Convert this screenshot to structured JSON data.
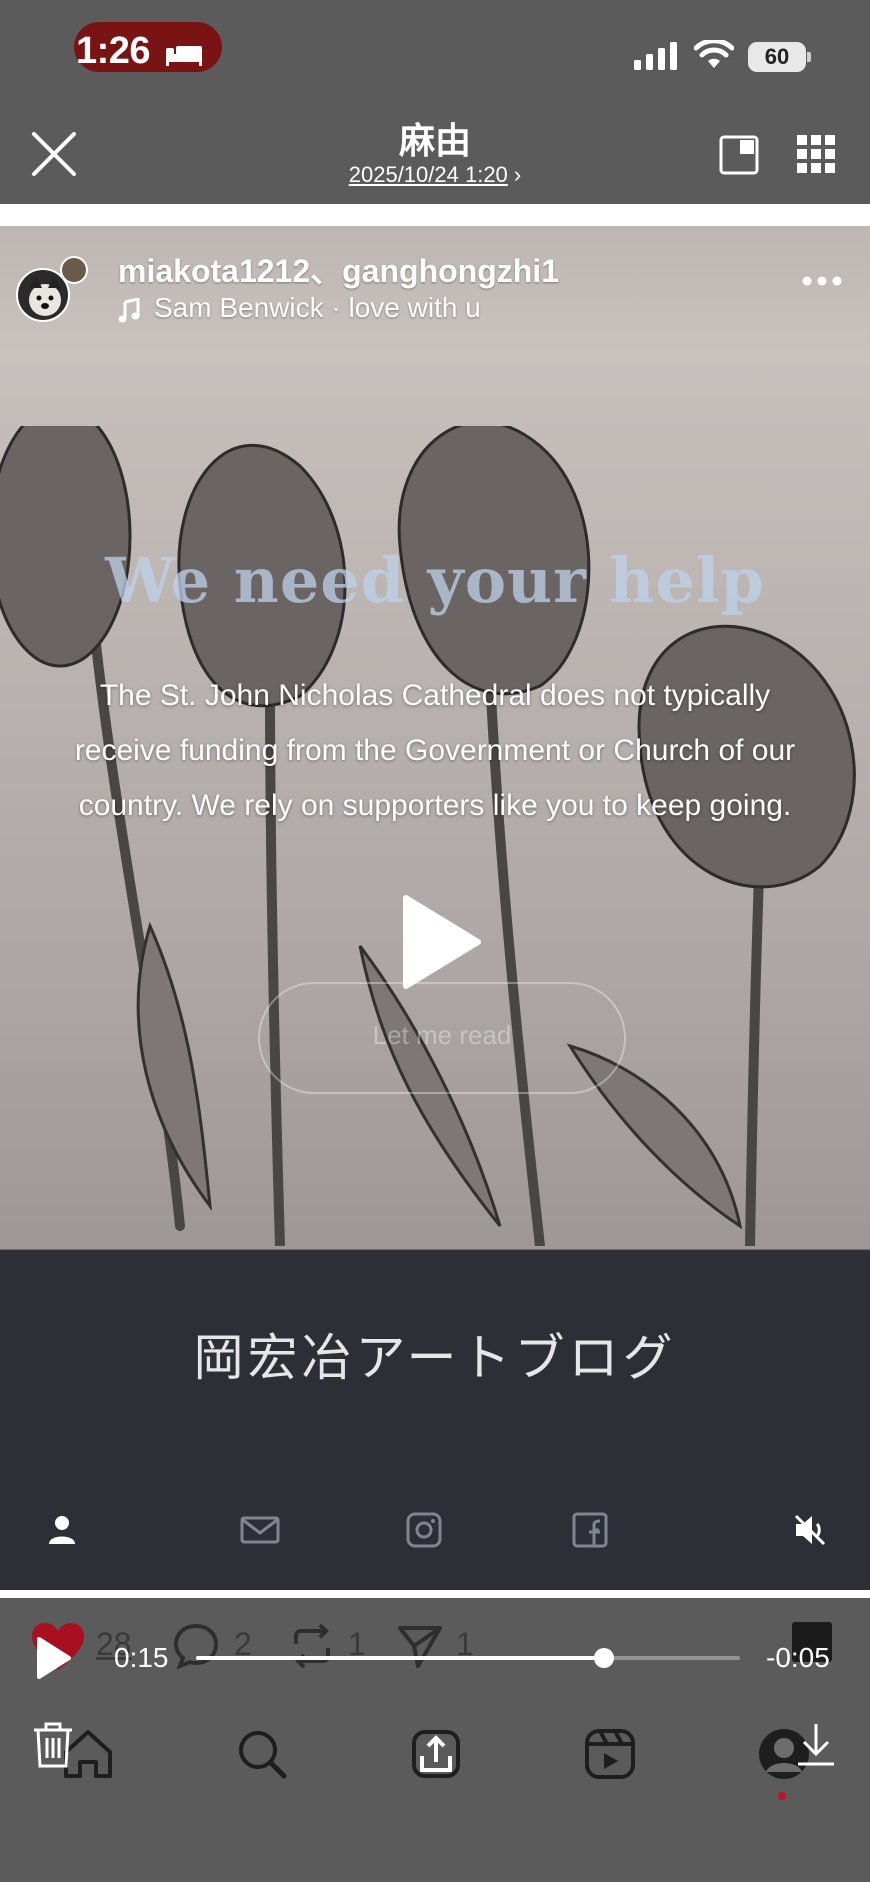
{
  "status_bar": {
    "time": "1:26",
    "battery": "60",
    "icons": [
      "sleep-icon",
      "cellular-signal-icon",
      "wifi-icon",
      "battery-icon"
    ]
  },
  "header": {
    "title": "麻由",
    "subtitle": "2025/10/24 1:20",
    "subtitle_suffix": "›",
    "icons": [
      "close-icon",
      "picture-in-picture-icon",
      "grid-icon"
    ]
  },
  "post": {
    "usernames": "miakota1212、ganghongzhi1",
    "music": "Sam Benwick · love with u",
    "help_title": "We need your help",
    "help_body": "The St. John Nicholas Cathedral does not typically receive funding from the Government or Church of our country. We rely on supporters like you to keep going.",
    "ghost_button": "Let me read",
    "blog_title": "岡宏冶アートブログ",
    "social_icons": [
      "person-icon",
      "mail-icon",
      "instagram-icon",
      "facebook-icon"
    ],
    "mute_icon": "muted-speaker-icon"
  },
  "actions": {
    "likes": "28",
    "comments": "2",
    "reposts": "1",
    "shares": "1",
    "accent_color": "#c0122c"
  },
  "player": {
    "elapsed": "0:15",
    "remaining": "-0:05",
    "progress": 0.75
  },
  "tab_bar": {
    "tabs": [
      "home-icon",
      "search-icon",
      "create-icon",
      "reels-icon",
      "profile-icon"
    ]
  }
}
